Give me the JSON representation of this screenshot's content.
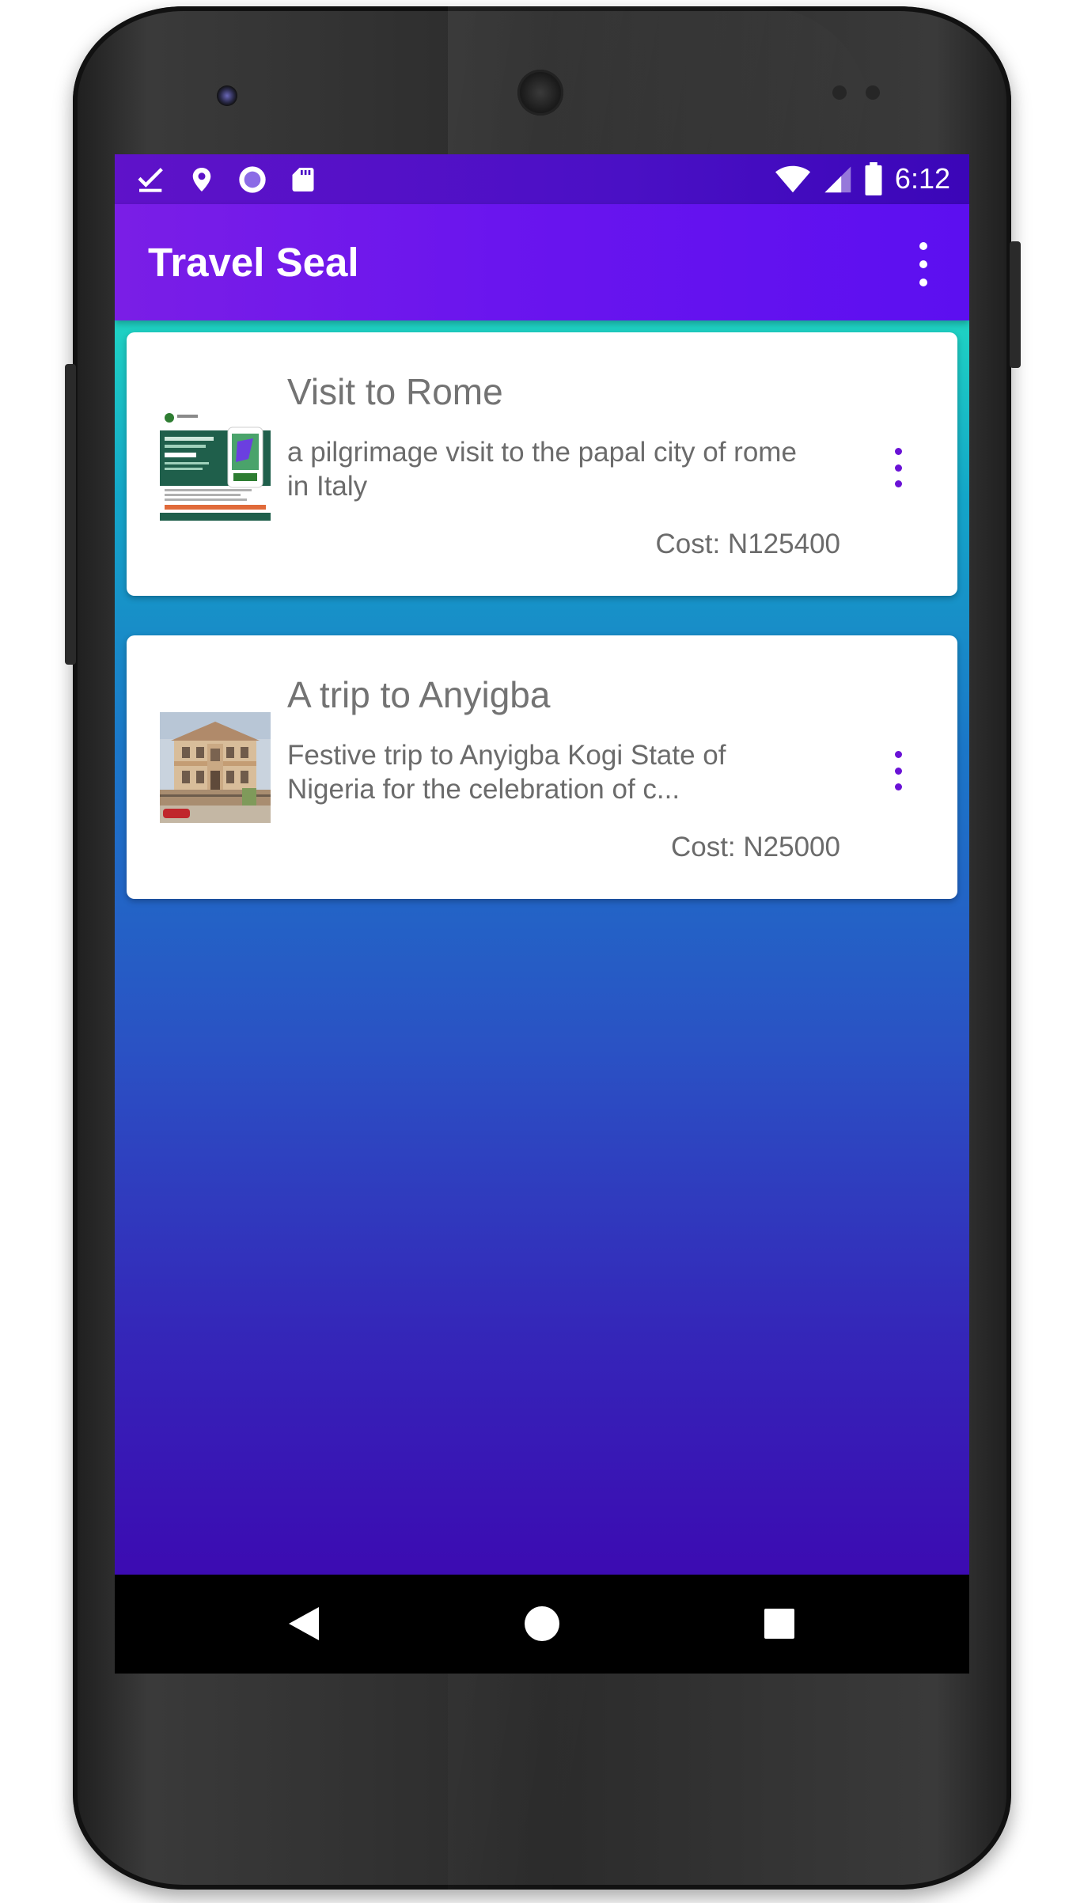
{
  "colors": {
    "accent": "#6a15ee",
    "status_bar": "#4a10c5",
    "card_menu_dots": "#6a12d6",
    "gradient_top": "#1fd3c3",
    "gradient_bottom": "#3c0bb2"
  },
  "status_bar": {
    "left_icons": [
      "download-done-icon",
      "location-pin-icon",
      "radio-button-icon",
      "sd-card-icon"
    ],
    "right_icons": [
      "wifi-icon",
      "cell-signal-icon",
      "battery-icon"
    ],
    "time": "6:12"
  },
  "app_bar": {
    "title": "Travel Seal",
    "menu_icon": "more-vert-icon"
  },
  "trips": [
    {
      "title": "Visit to Rome",
      "description": "a pilgrimage visit to the papal city of rome in Italy",
      "cost": "Cost: N125400",
      "thumbnail": "flyer-image"
    },
    {
      "title": "A trip to Anyigba",
      "description": "Festive trip to Anyigba Kogi State of Nigeria for the celebration of c...",
      "cost": "Cost: N25000",
      "thumbnail": "building-photo"
    }
  ],
  "nav_bar": {
    "back": "back-triangle-icon",
    "home": "home-circle-icon",
    "recents": "recents-square-icon"
  }
}
